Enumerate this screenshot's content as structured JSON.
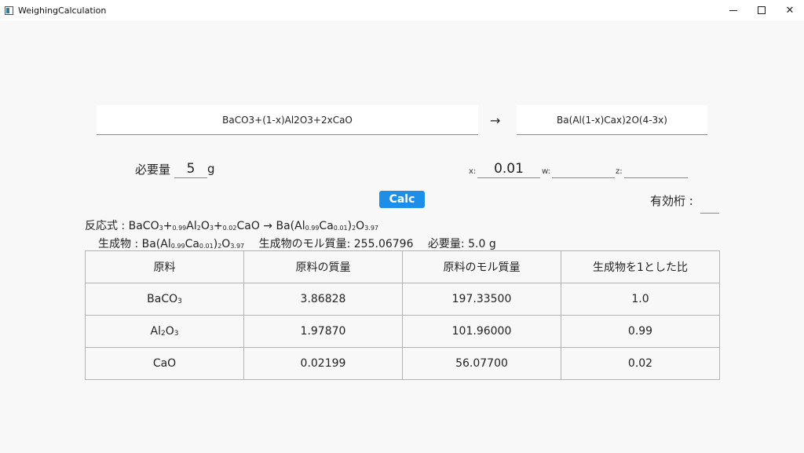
{
  "window": {
    "title": "WeighingCalculation",
    "minimize": "—",
    "maximize": "□",
    "close": "✕"
  },
  "reaction": {
    "reactants": "BaCO3+(1-x)Al2O3+2xCaO",
    "arrow": "→",
    "product": "Ba(Al(1-x)Cax)2O(4-3x)"
  },
  "amount": {
    "label": "必要量",
    "value": "5",
    "unit": "g"
  },
  "params": {
    "x_label": "x:",
    "x_value": "0.01",
    "w_label": "w:",
    "w_value": "",
    "z_label": "z:",
    "z_value": ""
  },
  "calc_label": "Calc",
  "sigfig_label": "有効桁 :",
  "sigfig_value": "",
  "result_lines": {
    "reaction_prefix": "反応式 : ",
    "product_prefix": "生成物 : ",
    "molar_mass_label": "生成物のモル質量: ",
    "molar_mass_value": "255.06796",
    "required_label": "必要量: ",
    "required_value": "5.0 g"
  },
  "table": {
    "headers": [
      "原料",
      "原料の質量",
      "原料のモル質量",
      "生成物を1とした比"
    ],
    "rows": [
      {
        "material": "BaCO3",
        "mass": "3.86828",
        "molar_mass": "197.33500",
        "ratio": "1.0"
      },
      {
        "material": "Al2O3",
        "mass": "1.97870",
        "molar_mass": "101.96000",
        "ratio": "0.99"
      },
      {
        "material": "CaO",
        "mass": "0.02199",
        "molar_mass": "56.07700",
        "ratio": "0.02"
      }
    ]
  },
  "colors": {
    "accent": "#1e8fe8",
    "background": "#f8f8f8"
  }
}
